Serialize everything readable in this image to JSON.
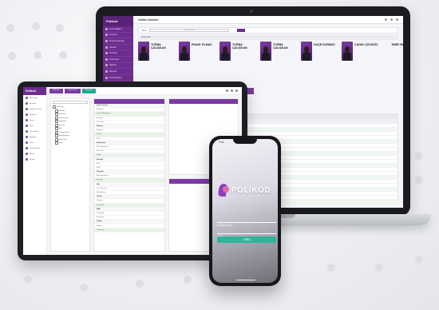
{
  "laptop": {
    "logo": "Polikod",
    "title": "Online Islemler",
    "filter_label": "Birim",
    "filter_value": "Birim Seçiniz",
    "section_label": "Personeller",
    "sidebar": [
      "Kurum Bilgileri",
      "Personel",
      "Personel İşlemleri",
      "Nöbetler",
      "Bordrolar",
      "Performans",
      "Eğitimler",
      "Raporlar",
      "Evrak Talepleri",
      "Görev Kayıtları",
      "Ayarlar",
      "Dokümanlar",
      "Duyurular",
      "Bildirimler"
    ],
    "cards": [
      {
        "name": "TUĞBA ÇALIŞKAN",
        "photo": true
      },
      {
        "name": "PINAR YILMAZ",
        "photo": true
      },
      {
        "name": "TUĞBA ÇALIŞKAN",
        "photo": true
      },
      {
        "name": "TUĞBA ÇALIŞKAN",
        "photo": true
      },
      {
        "name": "DUÇE DURMAZ",
        "photo": true
      },
      {
        "name": "CANSU ÇELİKÖZ",
        "photo": true
      },
      {
        "name": "EMİR PARLAK",
        "photo": false
      }
    ],
    "purple_row": [
      "MERVE KARAN",
      "NAZLI ARSLAN",
      "ÇELİKKAYA"
    ]
  },
  "tablet": {
    "logo": "Polikod",
    "tabs": [
      "Poliklinik",
      "Ödeme Planı",
      "Raporlar"
    ],
    "sidebar": [
      "Ana Sayfa",
      "Hastalar",
      "Randevu Listesi",
      "Poliklinik",
      "Fatura",
      "Stok",
      "Personeller",
      "Raporlar",
      "Kasa",
      "Tanımlamalar",
      "Ayarlar",
      "Destek"
    ],
    "tree": [
      "Kurumlar",
      "Birimler",
      "Polikinlik",
      "Laboratuvar",
      "Radyoloji",
      "Eczane",
      "Acil",
      "Yoğun Bakım",
      "Ameliyathane",
      "Muhasebe",
      "Arşiv"
    ],
    "list": [
      {
        "label": "Genel Cerrahi",
        "type": "grp"
      },
      {
        "label": "Muayene",
        "type": "item"
      },
      {
        "label": "Kontrol Muayenesi",
        "type": "green"
      },
      {
        "label": "Ameliyat",
        "type": "item"
      },
      {
        "label": "Pansuman",
        "type": "item"
      },
      {
        "label": "Dahiliye",
        "type": "grp"
      },
      {
        "label": "Muayene",
        "type": "item"
      },
      {
        "label": "Kontrol",
        "type": "green"
      },
      {
        "label": "EKG",
        "type": "item"
      },
      {
        "label": "Kardiyoloji",
        "type": "grp"
      },
      {
        "label": "Ekokardiyografi",
        "type": "item"
      },
      {
        "label": "Efor Testi",
        "type": "item"
      },
      {
        "label": "Holter",
        "type": "green"
      },
      {
        "label": "Nöroloji",
        "type": "grp"
      },
      {
        "label": "EEG",
        "type": "item"
      },
      {
        "label": "EMG",
        "type": "item"
      },
      {
        "label": "Ortopedi",
        "type": "grp"
      },
      {
        "label": "Alçı Uygulaması",
        "type": "item"
      },
      {
        "label": "Röntgen",
        "type": "green"
      },
      {
        "label": "Göz",
        "type": "grp"
      },
      {
        "label": "Göz Tansiyonu",
        "type": "item"
      },
      {
        "label": "Refraksiyon",
        "type": "item"
      },
      {
        "label": "Üroloji",
        "type": "grp"
      },
      {
        "label": "Ultrason",
        "type": "item"
      },
      {
        "label": "Sistoskopi",
        "type": "green"
      },
      {
        "label": "KBB",
        "type": "grp"
      },
      {
        "label": "Odyometri",
        "type": "item"
      },
      {
        "label": "Endoskopi",
        "type": "item"
      },
      {
        "label": "Cildiye",
        "type": "grp"
      },
      {
        "label": "Biyopsi",
        "type": "item"
      },
      {
        "label": "Kriyoterapi",
        "type": "green"
      }
    ]
  },
  "phone": {
    "time": "9:41",
    "brand": "POLİKOD",
    "username_placeholder": "Kullanıcı Adı",
    "password_placeholder": "Şifre",
    "login_label": "GİRİŞ"
  },
  "colors": {
    "purple": "#6d2c8f",
    "teal": "#2fb59c"
  }
}
